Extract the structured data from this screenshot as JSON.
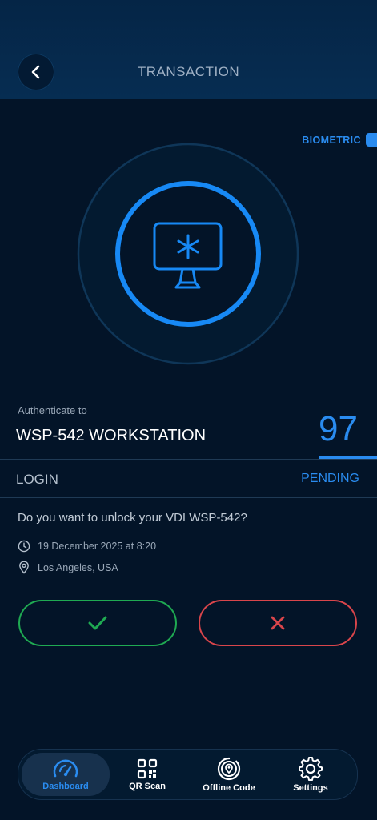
{
  "header": {
    "title": "TRANSACTION"
  },
  "biometric": {
    "label": "BIOMETRIC"
  },
  "transaction": {
    "auth_prefix": "Authenticate to",
    "device_name": "WSP-542 WORKSTATION",
    "counter": "97",
    "type": "LOGIN",
    "status": "PENDING",
    "question": "Do you want to unlock your VDI WSP-542?",
    "datetime": "19 December 2025 at 8:20",
    "location": "Los Angeles, USA"
  },
  "icons": {
    "back": "chevron-left-icon",
    "center": "workstation-icon",
    "clock": "clock-icon",
    "location": "location-pin-icon",
    "approve": "check-icon",
    "deny": "close-icon"
  },
  "colors": {
    "accent": "#2a8cf0",
    "approve": "#1faa52",
    "deny": "#d9454b",
    "background": "#031428",
    "header": "#052546"
  },
  "nav": {
    "items": [
      {
        "label": "Dashboard",
        "icon": "speedometer-icon",
        "active": true
      },
      {
        "label": "QR Scan",
        "icon": "qr-code-icon",
        "active": false
      },
      {
        "label": "Offline Code",
        "icon": "offline-code-icon",
        "active": false
      },
      {
        "label": "Settings",
        "icon": "gear-icon",
        "active": false
      }
    ]
  }
}
